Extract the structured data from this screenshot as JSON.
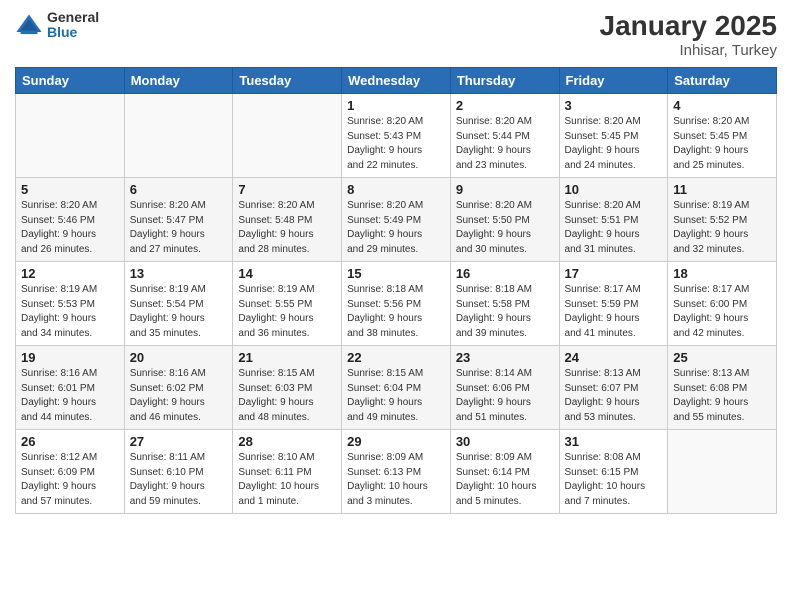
{
  "header": {
    "logo_general": "General",
    "logo_blue": "Blue",
    "title": "January 2025",
    "subtitle": "Inhisar, Turkey"
  },
  "weekdays": [
    "Sunday",
    "Monday",
    "Tuesday",
    "Wednesday",
    "Thursday",
    "Friday",
    "Saturday"
  ],
  "weeks": [
    [
      {
        "day": "",
        "info": ""
      },
      {
        "day": "",
        "info": ""
      },
      {
        "day": "",
        "info": ""
      },
      {
        "day": "1",
        "info": "Sunrise: 8:20 AM\nSunset: 5:43 PM\nDaylight: 9 hours\nand 22 minutes."
      },
      {
        "day": "2",
        "info": "Sunrise: 8:20 AM\nSunset: 5:44 PM\nDaylight: 9 hours\nand 23 minutes."
      },
      {
        "day": "3",
        "info": "Sunrise: 8:20 AM\nSunset: 5:45 PM\nDaylight: 9 hours\nand 24 minutes."
      },
      {
        "day": "4",
        "info": "Sunrise: 8:20 AM\nSunset: 5:45 PM\nDaylight: 9 hours\nand 25 minutes."
      }
    ],
    [
      {
        "day": "5",
        "info": "Sunrise: 8:20 AM\nSunset: 5:46 PM\nDaylight: 9 hours\nand 26 minutes."
      },
      {
        "day": "6",
        "info": "Sunrise: 8:20 AM\nSunset: 5:47 PM\nDaylight: 9 hours\nand 27 minutes."
      },
      {
        "day": "7",
        "info": "Sunrise: 8:20 AM\nSunset: 5:48 PM\nDaylight: 9 hours\nand 28 minutes."
      },
      {
        "day": "8",
        "info": "Sunrise: 8:20 AM\nSunset: 5:49 PM\nDaylight: 9 hours\nand 29 minutes."
      },
      {
        "day": "9",
        "info": "Sunrise: 8:20 AM\nSunset: 5:50 PM\nDaylight: 9 hours\nand 30 minutes."
      },
      {
        "day": "10",
        "info": "Sunrise: 8:20 AM\nSunset: 5:51 PM\nDaylight: 9 hours\nand 31 minutes."
      },
      {
        "day": "11",
        "info": "Sunrise: 8:19 AM\nSunset: 5:52 PM\nDaylight: 9 hours\nand 32 minutes."
      }
    ],
    [
      {
        "day": "12",
        "info": "Sunrise: 8:19 AM\nSunset: 5:53 PM\nDaylight: 9 hours\nand 34 minutes."
      },
      {
        "day": "13",
        "info": "Sunrise: 8:19 AM\nSunset: 5:54 PM\nDaylight: 9 hours\nand 35 minutes."
      },
      {
        "day": "14",
        "info": "Sunrise: 8:19 AM\nSunset: 5:55 PM\nDaylight: 9 hours\nand 36 minutes."
      },
      {
        "day": "15",
        "info": "Sunrise: 8:18 AM\nSunset: 5:56 PM\nDaylight: 9 hours\nand 38 minutes."
      },
      {
        "day": "16",
        "info": "Sunrise: 8:18 AM\nSunset: 5:58 PM\nDaylight: 9 hours\nand 39 minutes."
      },
      {
        "day": "17",
        "info": "Sunrise: 8:17 AM\nSunset: 5:59 PM\nDaylight: 9 hours\nand 41 minutes."
      },
      {
        "day": "18",
        "info": "Sunrise: 8:17 AM\nSunset: 6:00 PM\nDaylight: 9 hours\nand 42 minutes."
      }
    ],
    [
      {
        "day": "19",
        "info": "Sunrise: 8:16 AM\nSunset: 6:01 PM\nDaylight: 9 hours\nand 44 minutes."
      },
      {
        "day": "20",
        "info": "Sunrise: 8:16 AM\nSunset: 6:02 PM\nDaylight: 9 hours\nand 46 minutes."
      },
      {
        "day": "21",
        "info": "Sunrise: 8:15 AM\nSunset: 6:03 PM\nDaylight: 9 hours\nand 48 minutes."
      },
      {
        "day": "22",
        "info": "Sunrise: 8:15 AM\nSunset: 6:04 PM\nDaylight: 9 hours\nand 49 minutes."
      },
      {
        "day": "23",
        "info": "Sunrise: 8:14 AM\nSunset: 6:06 PM\nDaylight: 9 hours\nand 51 minutes."
      },
      {
        "day": "24",
        "info": "Sunrise: 8:13 AM\nSunset: 6:07 PM\nDaylight: 9 hours\nand 53 minutes."
      },
      {
        "day": "25",
        "info": "Sunrise: 8:13 AM\nSunset: 6:08 PM\nDaylight: 9 hours\nand 55 minutes."
      }
    ],
    [
      {
        "day": "26",
        "info": "Sunrise: 8:12 AM\nSunset: 6:09 PM\nDaylight: 9 hours\nand 57 minutes."
      },
      {
        "day": "27",
        "info": "Sunrise: 8:11 AM\nSunset: 6:10 PM\nDaylight: 9 hours\nand 59 minutes."
      },
      {
        "day": "28",
        "info": "Sunrise: 8:10 AM\nSunset: 6:11 PM\nDaylight: 10 hours\nand 1 minute."
      },
      {
        "day": "29",
        "info": "Sunrise: 8:09 AM\nSunset: 6:13 PM\nDaylight: 10 hours\nand 3 minutes."
      },
      {
        "day": "30",
        "info": "Sunrise: 8:09 AM\nSunset: 6:14 PM\nDaylight: 10 hours\nand 5 minutes."
      },
      {
        "day": "31",
        "info": "Sunrise: 8:08 AM\nSunset: 6:15 PM\nDaylight: 10 hours\nand 7 minutes."
      },
      {
        "day": "",
        "info": ""
      }
    ]
  ]
}
